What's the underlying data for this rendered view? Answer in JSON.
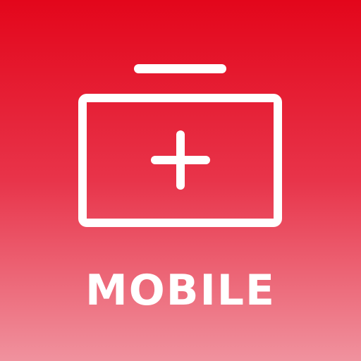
{
  "icon": {
    "name": "first-aid-kit-icon",
    "label": "MOBILE",
    "colors": {
      "gradient_top": "#E3061B",
      "gradient_bottom": "#F0929E",
      "foreground": "#FFFFFF"
    }
  }
}
